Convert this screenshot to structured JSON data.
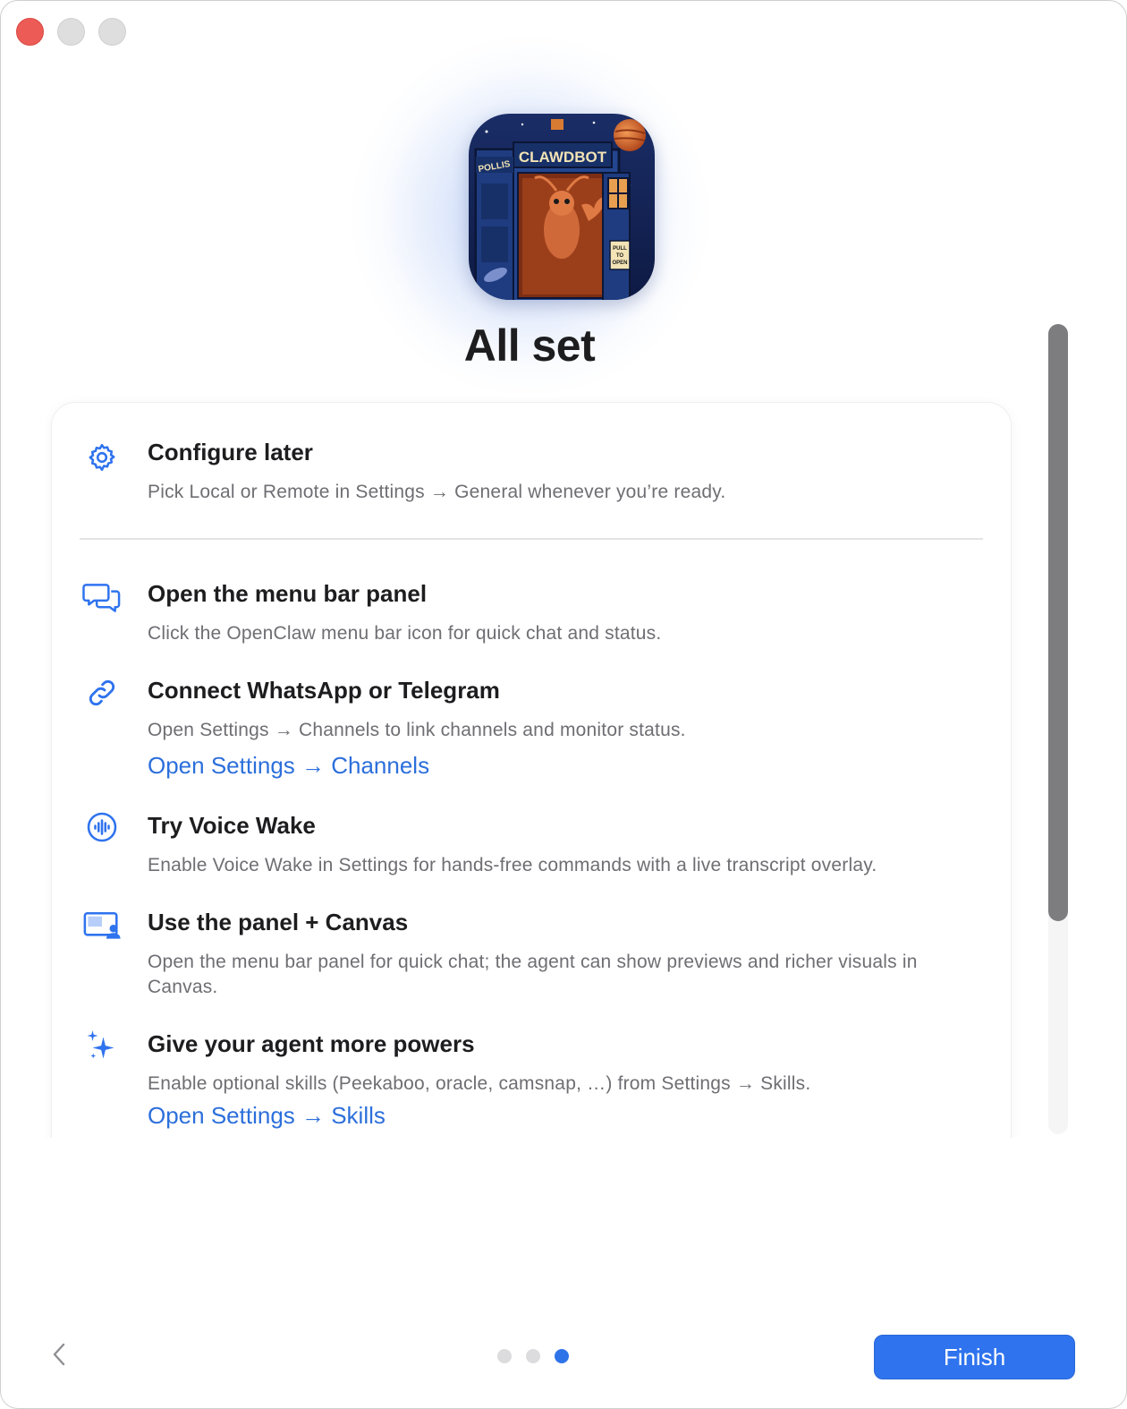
{
  "window": {
    "controls": [
      "close",
      "minimize",
      "zoom"
    ]
  },
  "header": {
    "app_icon": {
      "name": "clawdbot-app-icon",
      "sign_text": "CLAWDBOT",
      "side_text": "POLLIS",
      "door_sign": "PULL TO OPEN"
    },
    "title": "All set"
  },
  "items": [
    {
      "icon": "gear-icon",
      "heading": "Configure later",
      "description": "Pick Local or Remote in Settings → General whenever you’re ready."
    },
    {
      "icon": "chat-bubbles-icon",
      "heading": "Open the menu bar panel",
      "description": "Click the OpenClaw menu bar icon for quick chat and status."
    },
    {
      "icon": "link-icon",
      "heading": "Connect WhatsApp or Telegram",
      "description": "Open Settings → Channels to link channels and monitor status.",
      "link": "Open Settings → Channels"
    },
    {
      "icon": "waveform-icon",
      "heading": "Try Voice Wake",
      "description": "Enable Voice Wake in Settings for hands-free commands with a live transcript overlay."
    },
    {
      "icon": "canvas-icon",
      "heading": "Use the panel + Canvas",
      "description": "Open the menu bar panel for quick chat; the agent can show previews and richer visuals in Canvas."
    },
    {
      "icon": "sparkles-icon",
      "heading": "Give your agent more powers",
      "description": "Enable optional skills (Peekaboo, oracle, camsnap, …) from Settings → Skills.",
      "link": "Open Settings → Skills"
    }
  ],
  "footer": {
    "back_icon": "chevron-left-icon",
    "pages": {
      "count": 3,
      "current": 3
    },
    "finish_label": "Finish"
  },
  "colors": {
    "accent": "#2f73ee",
    "link": "#2c6fdb",
    "close": "#ec5b55"
  }
}
